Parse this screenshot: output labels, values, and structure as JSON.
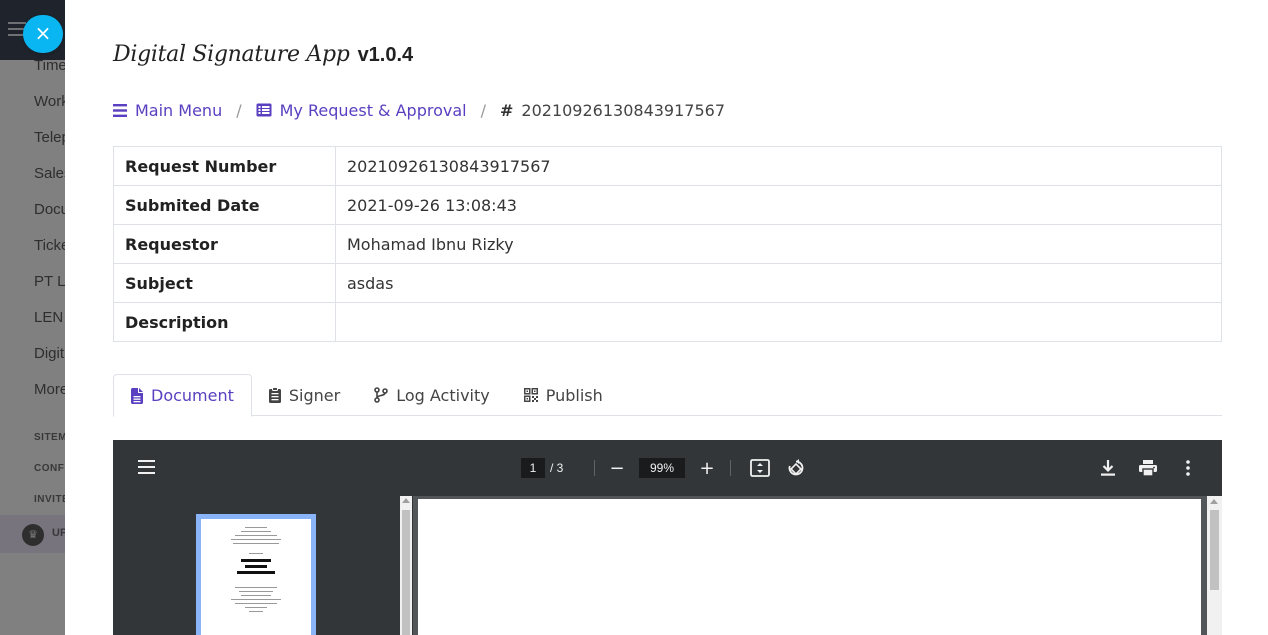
{
  "background": {
    "menu_items": [
      "Time",
      "Work",
      "Telep",
      "Sales",
      "Docu",
      "Ticke",
      "PT Le",
      "LEN",
      "Digit",
      "More"
    ],
    "sections": [
      "SITEM",
      "CONFI",
      "INVITE"
    ],
    "upgrade_label": "UP"
  },
  "close_button": {
    "label": "×"
  },
  "app": {
    "title": "Digital Signature App",
    "version": "v1.0.4"
  },
  "breadcrumb": {
    "main_menu": "Main Menu",
    "requests": "My Request & Approval",
    "current": "20210926130843917567"
  },
  "details": {
    "rows": [
      {
        "label": "Request Number",
        "value": "20210926130843917567"
      },
      {
        "label": "Submited Date",
        "value": "2021-09-26 13:08:43"
      },
      {
        "label": "Requestor",
        "value": "Mohamad Ibnu Rizky"
      },
      {
        "label": "Subject",
        "value": "asdas"
      },
      {
        "label": "Description",
        "value": ""
      }
    ]
  },
  "tabs": [
    {
      "label": "Document",
      "active": true,
      "icon": "file-icon"
    },
    {
      "label": "Signer",
      "active": false,
      "icon": "clipboard-icon"
    },
    {
      "label": "Log Activity",
      "active": false,
      "icon": "code-branch-icon"
    },
    {
      "label": "Publish",
      "active": false,
      "icon": "qrcode-icon"
    }
  ],
  "pdf_viewer": {
    "current_page": "1",
    "total_pages": "/  3",
    "zoom": "99%",
    "zoom_out": "−",
    "zoom_in": "+"
  },
  "colors": {
    "accent": "#5a3fc0",
    "close_button": "#09b6f2",
    "pdf_toolbar": "#323639",
    "pdf_background": "#525659",
    "thumbnail_highlight": "#8ab4f8"
  }
}
